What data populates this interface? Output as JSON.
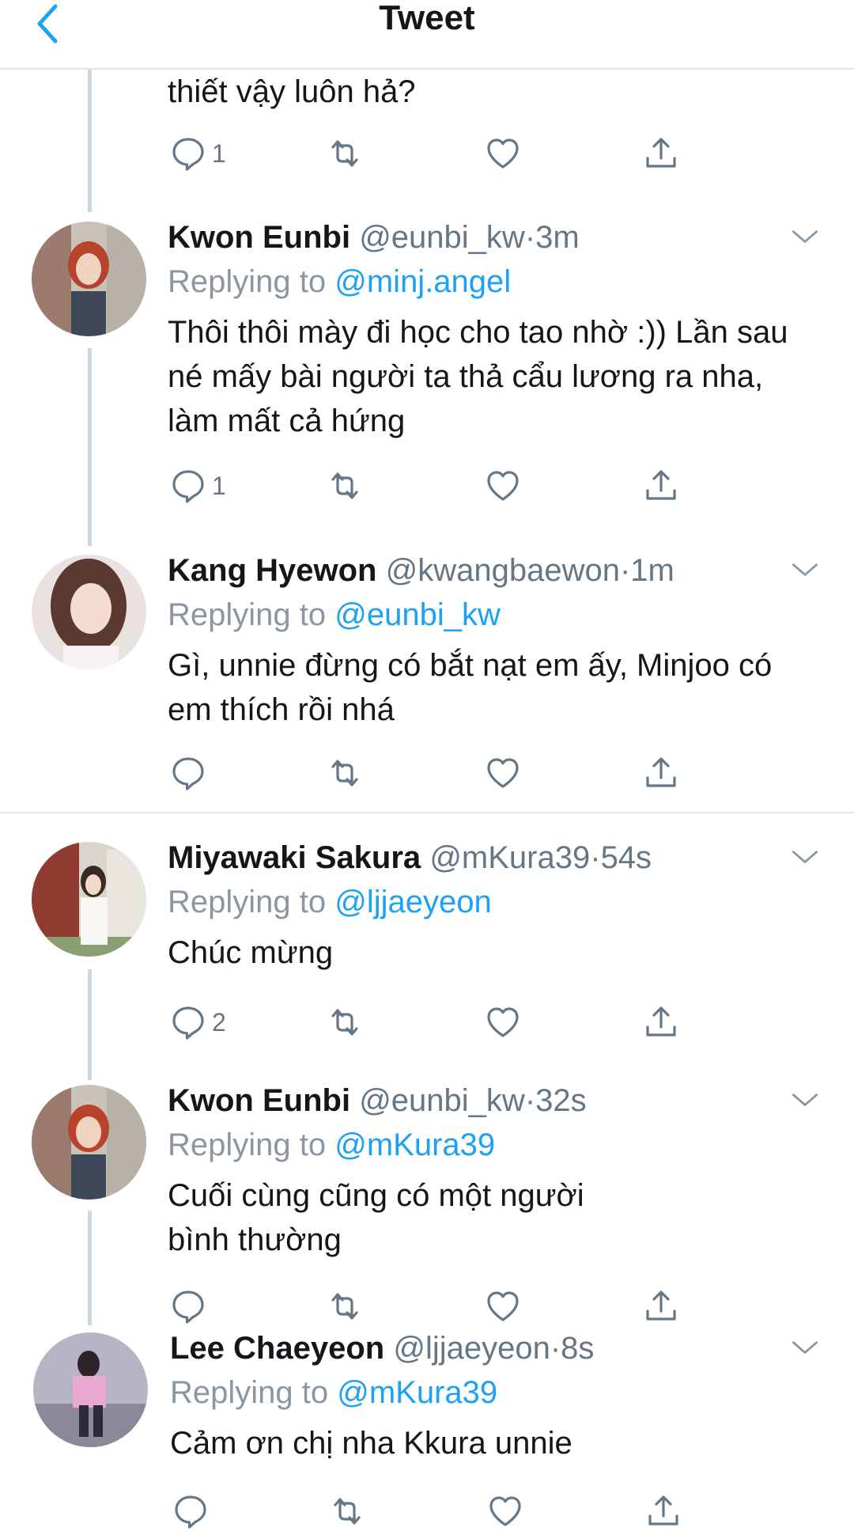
{
  "header": {
    "title": "Tweet"
  },
  "colors": {
    "accent": "#1da1f2",
    "icon": "#657786",
    "thread_line": "#ccd6dd"
  },
  "top_fragment": {
    "text": "thiết vậy luôn hả?",
    "reply_count": "1"
  },
  "tweets": [
    {
      "name": "Kwon Eunbi",
      "handle": "@eunbi_kw",
      "sep": "·",
      "time": "3m",
      "replying_label": "Replying to",
      "replying_to": "@minj.angel",
      "text": "Thôi thôi mày đi học cho tao nhờ :)) Lần sau né mấy bài người ta thả cẩu lương ra nha, làm mất cả hứng",
      "reply_count": "1"
    },
    {
      "name": "Kang Hyewon",
      "handle": "@kwangbaewon",
      "sep": "·",
      "time": "1m",
      "replying_label": "Replying to",
      "replying_to": "@eunbi_kw",
      "text": "Gì, unnie đừng có bắt nạt em ấy, Minjoo có em thích rồi nhá",
      "reply_count": ""
    },
    {
      "name": "Miyawaki Sakura",
      "handle": "@mKura39",
      "sep": "·",
      "time": "54s",
      "replying_label": "Replying to",
      "replying_to": "@ljjaeyeon",
      "text": "Chúc mừng",
      "reply_count": "2"
    },
    {
      "name": "Kwon Eunbi",
      "handle": "@eunbi_kw",
      "sep": "·",
      "time": "32s",
      "replying_label": "Replying to",
      "replying_to": "@mKura39",
      "text": "Cuối cùng cũng có một người bình thường",
      "reply_count": ""
    },
    {
      "name": "Lee Chaeyeon",
      "handle": "@ljjaeyeon",
      "sep": "·",
      "time": "8s",
      "replying_label": "Replying to",
      "replying_to": "@mKura39",
      "text": "Cảm ơn chị nha Kkura unnie",
      "reply_count": ""
    }
  ]
}
